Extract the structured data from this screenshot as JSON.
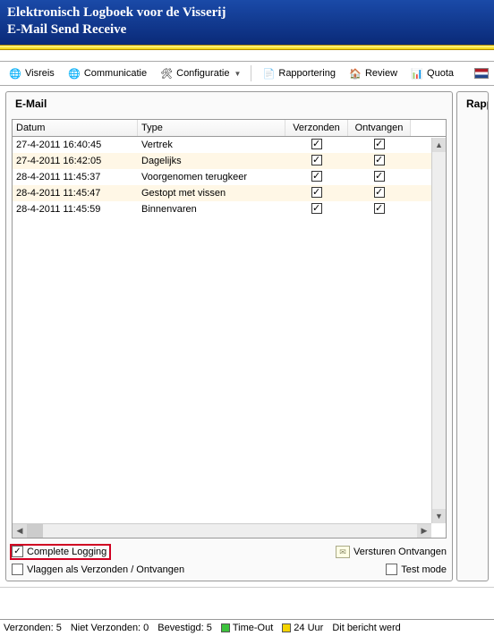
{
  "title": {
    "line1": "Elektronisch Logboek voor de Visserij",
    "line2": "E-Mail Send Receive"
  },
  "menu": {
    "visreis": "Visreis",
    "communicatie": "Communicatie",
    "configuratie": "Configuratie",
    "rapportering": "Rapportering",
    "review": "Review",
    "quota": "Quota"
  },
  "panel": {
    "left_title": "E-Mail",
    "right_title": "Rapp"
  },
  "table": {
    "headers": {
      "datum": "Datum",
      "type": "Type",
      "verzonden": "Verzonden",
      "ontvangen": "Ontvangen"
    },
    "rows": [
      {
        "datum": "27-4-2011 16:40:45",
        "type": "Vertrek",
        "verz": true,
        "ontv": true
      },
      {
        "datum": "27-4-2011 16:42:05",
        "type": "Dagelijks",
        "verz": true,
        "ontv": true
      },
      {
        "datum": "28-4-2011 11:45:37",
        "type": "Voorgenomen terugkeer",
        "verz": true,
        "ontv": true
      },
      {
        "datum": "28-4-2011 11:45:47",
        "type": "Gestopt met vissen",
        "verz": true,
        "ontv": true
      },
      {
        "datum": "28-4-2011 11:45:59",
        "type": "Binnenvaren",
        "verz": true,
        "ontv": true
      }
    ]
  },
  "controls": {
    "complete_logging": "Complete Logging",
    "versturen_ontvangen": "Versturen Ontvangen",
    "vlaggen": "Vlaggen als Verzonden / Ontvangen",
    "test_mode": "Test mode"
  },
  "status": {
    "verzonden": "Verzonden: 5",
    "niet_verzonden": "Niet Verzonden: 0",
    "bevestigd": "Bevestigd: 5",
    "timeout": "Time-Out",
    "u24": "24 Uur",
    "bericht": "Dit bericht werd"
  }
}
